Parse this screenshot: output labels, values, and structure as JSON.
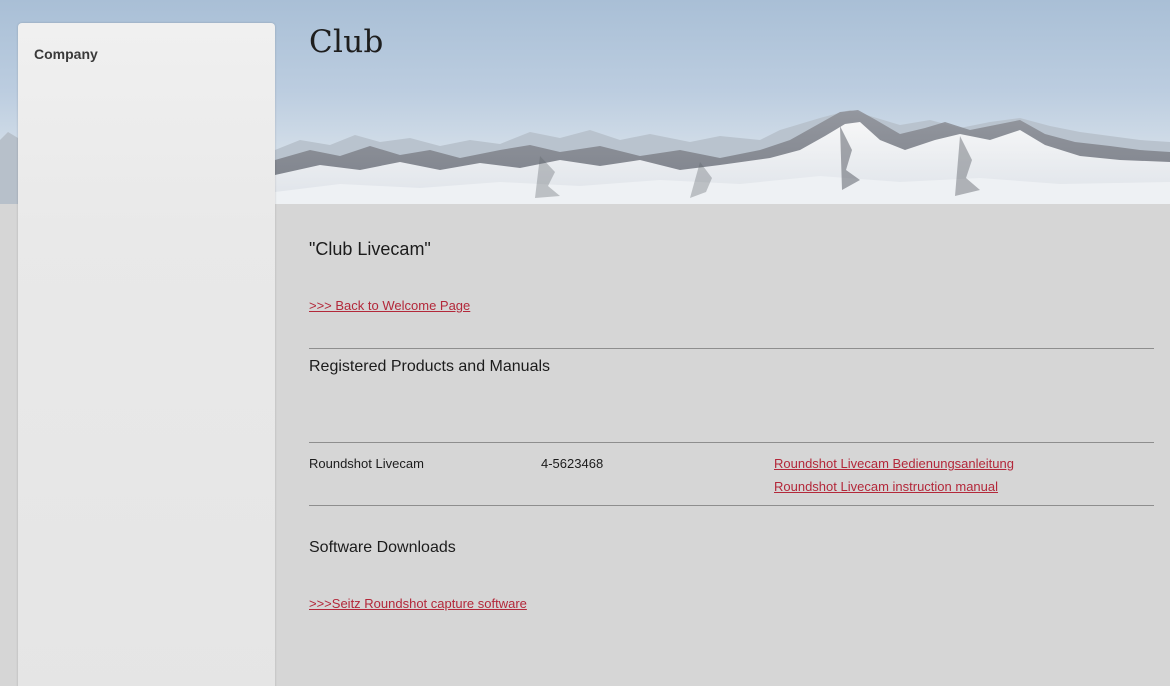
{
  "header": {
    "title": "Club"
  },
  "sidebar": {
    "title": "Company"
  },
  "main": {
    "heading": "\"Club Livecam\"",
    "back_link": ">>> Back to Welcome Page",
    "products": {
      "heading": "Registered Products and Manuals",
      "rows": [
        {
          "name": "Roundshot Livecam",
          "serial": "4-5623468",
          "manuals": [
            "Roundshot Livecam Bedienungsanleitung",
            "Roundshot Livecam instruction manual"
          ]
        }
      ]
    },
    "downloads": {
      "heading": "Software Downloads",
      "link": ">>>Seitz Roundshot capture software"
    }
  },
  "colors": {
    "link": "#b3283a",
    "background": "#d6d6d6",
    "sidebar": "#e9e9e9",
    "sky": "#b4c8dc"
  },
  "banner": {
    "image": "snowy-mountain-panorama"
  }
}
